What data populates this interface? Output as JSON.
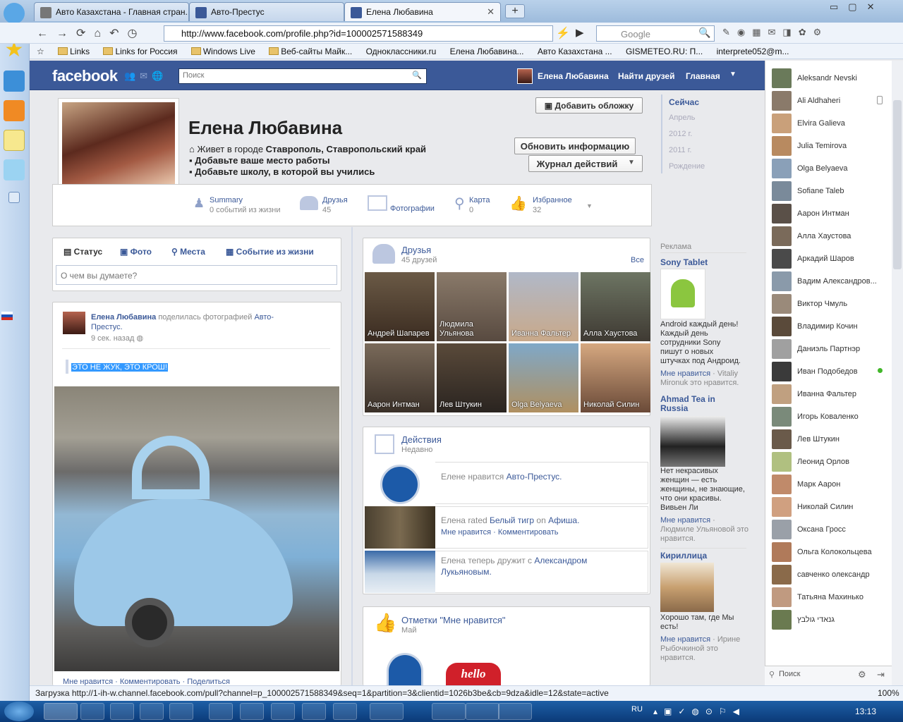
{
  "browser": {
    "tabs": [
      {
        "title": "Авто Казахстана - Главная стран..."
      },
      {
        "title": "Авто-Престус"
      },
      {
        "title": "Елена Любавина"
      }
    ],
    "url": "http://www.facebook.com/profile.php?id=100002571588349",
    "search_placeholder": "Google",
    "bookmarks": [
      "Links",
      "Links for Россия",
      "Windows Live",
      "Веб-сайты Майк...",
      "Одноклассники.ru",
      "Елена Любавина...",
      "Авто Казахстана ...",
      "GISMETEO.RU: П...",
      "interprete052@m..."
    ],
    "status": "Загрузка http://1-ih-w.channel.facebook.com/pull?channel=p_100002571588349&seq=1&partition=3&clientid=1026b3be&cb=9dza&idle=12&state=active",
    "zoom": "100%"
  },
  "fb": {
    "logo": "facebook",
    "search_placeholder": "Поиск",
    "header_user": "Елена Любавина",
    "find_friends": "Найти друзей",
    "home": "Главная"
  },
  "profile": {
    "name": "Елена Любавина",
    "lives_prefix": "Живет в городе ",
    "lives_city": "Ставрополь, Ставропольский край",
    "add_work": "Добавьте ваше место работы",
    "add_school": "Добавьте школу, в которой вы учились",
    "add_cover": "Добавить обложку",
    "update_info": "Обновить информацию",
    "activity_log": "Журнал действий"
  },
  "nav": [
    {
      "label": "Summary",
      "sub": "0 событий из жизни"
    },
    {
      "label": "Друзья",
      "sub": "45"
    },
    {
      "label": "Фотографии",
      "sub": ""
    },
    {
      "label": "Карта",
      "sub": "0"
    },
    {
      "label": "Избранное",
      "sub": "32"
    }
  ],
  "timeline": [
    "Сейчас",
    "Апрель",
    "2012 г.",
    "2011 г.",
    "Рождение"
  ],
  "composer": {
    "tabs": [
      "Статус",
      "Фото",
      "Места",
      "Событие из жизни"
    ],
    "placeholder": "О чем вы думаете?"
  },
  "post": {
    "author": "Елена Любавина",
    "action": " поделилась фотографией ",
    "target": "Авто-Престус.",
    "time": "9 сек. назад",
    "text": "ЭТО НЕ ЖУК, ЭТО КРОШ!",
    "actions": "Мне нравится · Комментировать · Поделиться"
  },
  "friends": {
    "title": "Друзья",
    "count": "45 друзей",
    "all": "Все",
    "list": [
      "Андрей Шапарев",
      "Людмила Ульянова",
      "Иванна Фальтер",
      "Алла Хаустова",
      "Аарон Интман",
      "Лев Штукин",
      "Olga Belyaeva",
      "Николай Силин"
    ]
  },
  "activity": {
    "title": "Действия",
    "sub": "Недавно",
    "items": [
      {
        "pre": "Елене нравится ",
        "link": "Авто-Престус.",
        "meta": ""
      },
      {
        "pre": "Елена rated ",
        "link": "Белый тигр",
        "mid": " on ",
        "link2": "Афиша.",
        "meta": "Мне нравится · Комментировать"
      },
      {
        "pre": "Елена теперь дружит с ",
        "link": "Александром Лукьяновым.",
        "meta": ""
      }
    ]
  },
  "likes": {
    "title": "Отметки \"Мне нравится\"",
    "sub": "Май",
    "hello": "hello"
  },
  "ads": {
    "label": "Реклама",
    "items": [
      {
        "title": "Sony Tablet",
        "desc": "Android каждый день! Каждый день сотрудники Sony пишут о новых штучках под Андроид.",
        "like": "Мне нравится",
        "by": " · Vitaliy Mironuk это нравится."
      },
      {
        "title": "Ahmad Tea in Russia",
        "desc": "Нет некрасивых женщин — есть женщины, не знающие, что они красивы. Вивьен Ли",
        "like": "Мне нравится",
        "by": " · Людмиле Ульяновой это нравится."
      },
      {
        "title": "Кириллица",
        "desc": "Хорошо там, где Мы есть!",
        "like": "Мне нравится",
        "by": " · Ирине Рыбочкиной это нравится."
      }
    ]
  },
  "chat": {
    "search": "Поиск",
    "contacts": [
      "Aleksandr Nevski",
      "Ali Aldhaheri",
      "Elvira Galieva",
      "Julia Temirova",
      "Olga Belyaeva",
      "Sofiane Taleb",
      "Аарон Интман",
      "Алла Хаустова",
      "Аркадий Шаров",
      "Вадим Александров...",
      "Виктор Чмуль",
      "Владимир Кочин",
      "Даниэль Партнэр",
      "Иван Подобедов",
      "Иванна Фальтер",
      "Игорь Коваленко",
      "Лев Штукин",
      "Леонид Орлов",
      "Марк Аарон",
      "Николай Силин",
      "Оксана Гросс",
      "Ольга Колокольцева",
      "савченко олександр",
      "Татьяна Махинько",
      "גנאדי גולבץ"
    ]
  },
  "taskbar": {
    "lang": "RU",
    "time": "13:13"
  }
}
